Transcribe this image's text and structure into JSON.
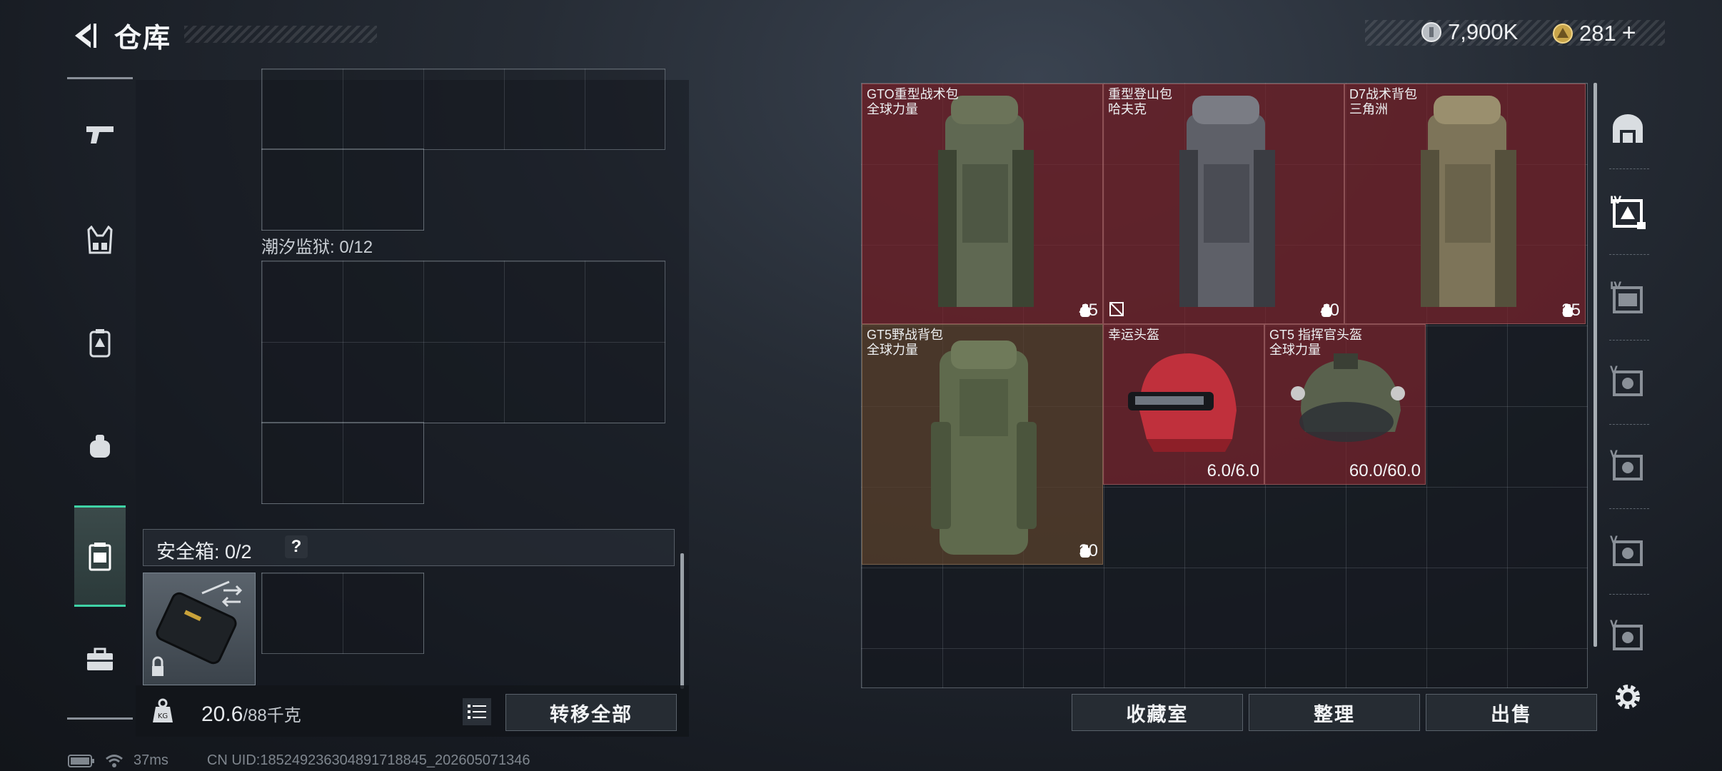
{
  "header": {
    "title": "仓库",
    "back_label": "back"
  },
  "currency": [
    {
      "icon": "silver-coin-icon",
      "value": "7,900K"
    },
    {
      "icon": "gold-triangle-coin-icon",
      "value": "281"
    }
  ],
  "left_nav": [
    {
      "icon": "pistol-icon",
      "name": "weapon"
    },
    {
      "icon": "chest-rig-icon",
      "name": "rig"
    },
    {
      "icon": "backpack-icon",
      "name": "backpack"
    },
    {
      "icon": "small-pouch-icon",
      "name": "pouch"
    },
    {
      "icon": "safe-box-icon",
      "name": "safe-box",
      "active": true
    },
    {
      "icon": "toolbox-icon",
      "name": "toolbox"
    }
  ],
  "left_panel": {
    "zone_label": "潮汐监狱: 0/12",
    "safe_box_label": "安全箱: 0/2",
    "help": "?",
    "weight_current": "20.6",
    "weight_max": "/88千克",
    "transfer_all": "转移全部"
  },
  "items": [
    {
      "name1": "GTO重型战术包",
      "name2": "全球力量",
      "value": "45",
      "value_icon": "capacity-icon",
      "rarity": "red",
      "color": "#6b7359"
    },
    {
      "name1": "重型登山包",
      "name2": "哈夫克",
      "value": "40",
      "value_icon": "capacity-icon",
      "flag_icon": "no-trade-icon",
      "rarity": "red",
      "color": "#6e7078"
    },
    {
      "name1": "D7战术背包",
      "name2": "三角洲",
      "value": "35",
      "value_icon": "capacity-icon",
      "rarity": "red",
      "color": "#8a8064"
    },
    {
      "name1": "GT5野战背包",
      "name2": "全球力量",
      "value": "30",
      "value_icon": "capacity-icon",
      "rarity": "brown",
      "color": "#5f6a4d"
    },
    {
      "name1": "幸运头盔",
      "name2": "",
      "value": "6.0/6.0",
      "rarity": "red",
      "color": "#c0303c"
    },
    {
      "name1": "GT5 指挥官头盔",
      "name2": "全球力量",
      "value": "60.0/60.0",
      "rarity": "red",
      "color": "#59614d"
    }
  ],
  "bottom_buttons": {
    "collection": "收藏室",
    "organize": "整理",
    "sell": "出售"
  },
  "right_side": [
    {
      "icon": "home-stash-icon"
    },
    {
      "icon": "stash-tab-iv-active-icon"
    },
    {
      "icon": "stash-tab-iv-icon"
    },
    {
      "icon": "stash-tab-v-icon"
    },
    {
      "icon": "stash-tab-v-icon"
    },
    {
      "icon": "stash-tab-v-icon"
    },
    {
      "icon": "stash-tab-v-icon"
    },
    {
      "icon": "settings-gear-icon"
    }
  ],
  "status": {
    "ping": "37ms",
    "uid": "CN UID:1852492363048917188​45_202605071346"
  }
}
